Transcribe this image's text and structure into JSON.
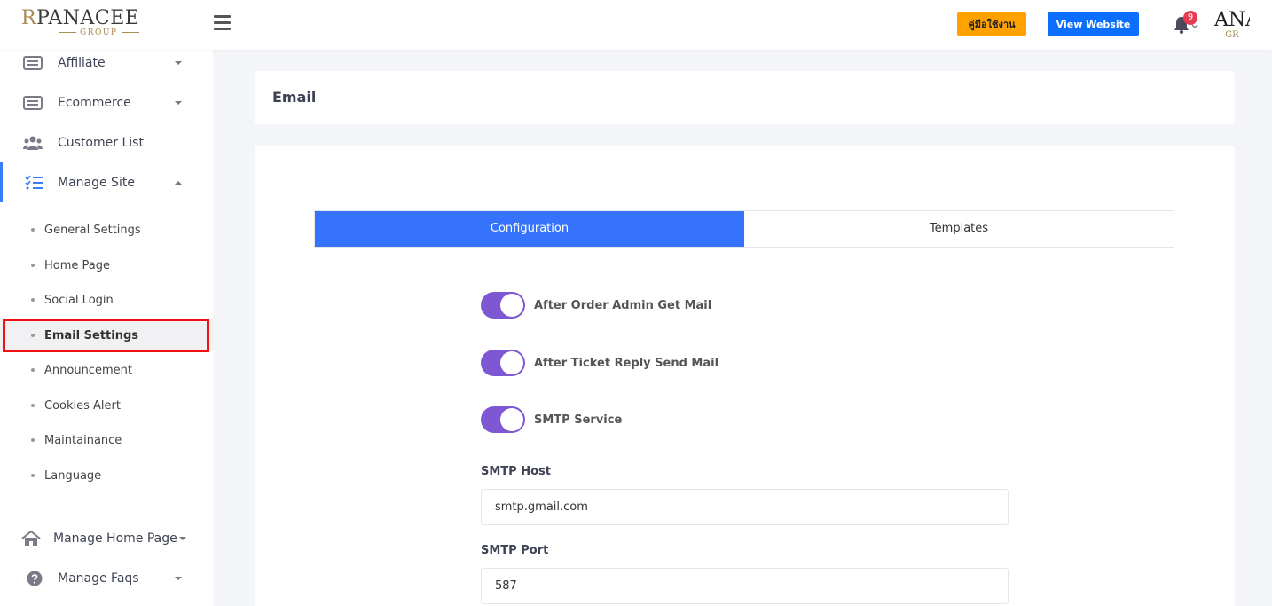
{
  "brand": {
    "logo_r": "R",
    "logo_main": "PANACEE",
    "logo_sub": "GROUP"
  },
  "header": {
    "manual_label": "คู่มือใช้งาน",
    "view_website_label": "View Website",
    "notification_count": "9",
    "avatar_main": "ANA",
    "avatar_sub": "– GR"
  },
  "sidebar": {
    "items": [
      {
        "label": "Affiliate",
        "icon": "list-icon"
      },
      {
        "label": "Ecommerce",
        "icon": "list-icon"
      },
      {
        "label": "Customer List",
        "icon": "users-icon"
      },
      {
        "label": "Manage Site",
        "icon": "tasks-icon"
      }
    ],
    "sub_items": [
      "General Settings",
      "Home Page",
      "Social Login",
      "Email Settings",
      "Announcement",
      "Cookies Alert",
      "Maintainance",
      "Language"
    ],
    "bottom_items": [
      {
        "label": "Manage Home Page",
        "icon": "home-icon"
      },
      {
        "label": "Manage Faqs",
        "icon": "question-icon"
      }
    ]
  },
  "page": {
    "title": "Email"
  },
  "tabs": [
    "Configuration",
    "Templates"
  ],
  "toggles": [
    {
      "label": "After Order Admin Get Mail",
      "on": true
    },
    {
      "label": "After Ticket Reply Send Mail",
      "on": true
    },
    {
      "label": "SMTP Service",
      "on": true
    }
  ],
  "fields": {
    "smtp_host_label": "SMTP Host",
    "smtp_host_value": "smtp.gmail.com",
    "smtp_port_label": "SMTP Port",
    "smtp_port_value": "587"
  },
  "colors": {
    "primary": "#3573fc",
    "toggle": "#7e57d3",
    "manual_button": "#ffa200",
    "view_button": "#0d6efd",
    "badge": "#e93b4f"
  }
}
